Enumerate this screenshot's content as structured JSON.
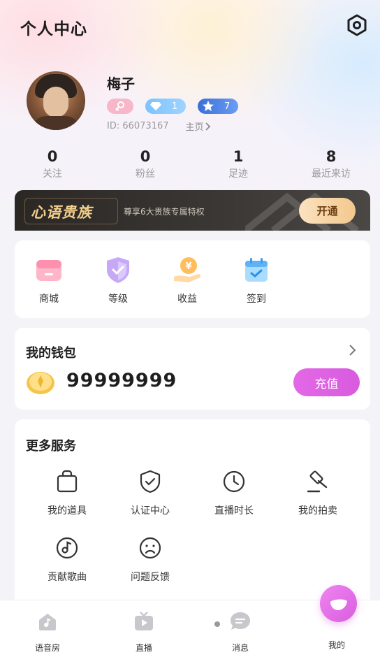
{
  "header": {
    "title": "个人中心",
    "settings_icon": "settings-hex-icon"
  },
  "profile": {
    "nickname": "梅子",
    "gender_icon": "female-icon",
    "diamond_level": "1",
    "star_level": "7",
    "id_text": "ID: 66073167",
    "homepage_label": "主页"
  },
  "stats": [
    {
      "value": "0",
      "label": "关注"
    },
    {
      "value": "0",
      "label": "粉丝"
    },
    {
      "value": "1",
      "label": "足迹"
    },
    {
      "value": "8",
      "label": "最近来访"
    }
  ],
  "vip": {
    "title": "心语贵族",
    "subtitle": "尊享6大贵族专属特权",
    "button": "开通",
    "colors": {
      "gold": "#f3cf8c",
      "button": "#f3c88d"
    }
  },
  "shop_items": [
    {
      "label": "商城",
      "icon": "store-icon"
    },
    {
      "label": "等级",
      "icon": "shield-check-icon"
    },
    {
      "label": "收益",
      "icon": "yuan-coin-icon"
    },
    {
      "label": "签到",
      "icon": "calendar-check-icon"
    }
  ],
  "wallet": {
    "title": "我的钱包",
    "balance": "99999999",
    "recharge": "充值",
    "accent": "#df64e3"
  },
  "more_services": {
    "title": "更多服务",
    "items": [
      {
        "label": "我的道具",
        "icon": "bag-icon"
      },
      {
        "label": "认证中心",
        "icon": "shield-check-icon"
      },
      {
        "label": "直播时长",
        "icon": "clock-icon"
      },
      {
        "label": "我的拍卖",
        "icon": "gavel-icon"
      },
      {
        "label": "贡献歌曲",
        "icon": "music-disc-icon"
      },
      {
        "label": "问题反馈",
        "icon": "sad-face-icon"
      }
    ]
  },
  "tabbar": [
    {
      "label": "语音房",
      "icon": "voice-room-icon"
    },
    {
      "label": "直播",
      "icon": "tv-icon"
    },
    {
      "label": "消息",
      "icon": "chat-icon"
    },
    {
      "label": "我的",
      "icon": "profile-blob-icon"
    }
  ]
}
